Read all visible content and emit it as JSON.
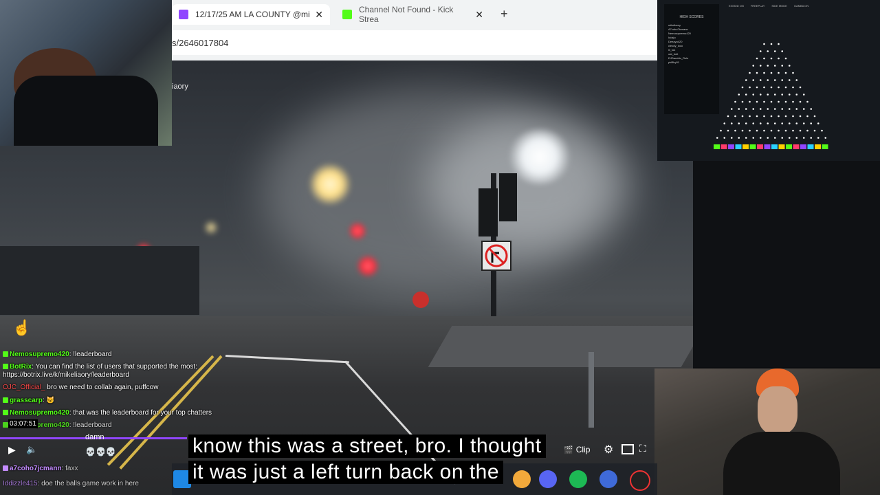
{
  "browser": {
    "tabs": [
      {
        "label": "12/17/25 AM LA COUNTY @mi",
        "close": "✕"
      },
      {
        "label": "Channel Not Found - Kick Strea",
        "close": "✕"
      }
    ],
    "new_tab": "+",
    "url": "s/2646017804",
    "page_fragment": "iaory"
  },
  "chat": [
    {
      "user": "Nemosupremo420",
      "sep": ":",
      "text": "!leaderboard",
      "color": "#53fc18"
    },
    {
      "user": "BotRix",
      "sep": ":",
      "text": "You can find the list of users that supported the most:",
      "color": "#53fc18"
    },
    {
      "user": "",
      "sep": "",
      "text": "https://botrix.live/k/mikeliaory/leaderboard",
      "color": "#ffffff"
    },
    {
      "user": "OJC_Official_",
      "sep": "",
      "text": "bro we need to collab again, puffcow",
      "color": "#ff4b4b"
    },
    {
      "user": "grasscarp",
      "sep": ":",
      "text": "🐱",
      "color": "#53fc18"
    },
    {
      "user": "Nemosupremo420",
      "sep": ":",
      "text": "that was the leaderboard for your top chatters",
      "color": "#53fc18"
    },
    {
      "user": "Nemosupremo420",
      "sep": ":",
      "text": "!leaderboard",
      "color": "#53fc18"
    },
    {
      "user": "a7coho7jcmann",
      "sep": ":",
      "text": "faxx",
      "color": "#c28bff"
    },
    {
      "user": "Iddizzle415",
      "sep": ":",
      "text": "doe the balls game work in here",
      "color": "#c28bff"
    }
  ],
  "player": {
    "time": "03:07:51",
    "chat_overlay": "damn",
    "emotes": "💀💀💀",
    "clip_label": "Clip"
  },
  "subtitles": {
    "line1": "know this was a street, bro. I thought",
    "line2": "it was just a left turn back on the"
  },
  "scoreboard": {
    "title": "HIGH SCORES",
    "top_labels": [
      "EXMOD ON",
      "FREEPLAY",
      "SIDE MODE",
      "GAMBA ON"
    ],
    "names": [
      "mikeliaory",
      "A7cobo7icmann",
      "Nemosupremo420",
      "Iddzjo",
      "Deeayo420",
      "cleody_loco",
      "lil_tok",
      "oat_bolt",
      "DJDandrio_Rule",
      "pkl8by01"
    ]
  },
  "colors": {
    "kick_green": "#53fc18",
    "twitch_purple": "#9146ff",
    "red_light": "#ff2a3a"
  }
}
